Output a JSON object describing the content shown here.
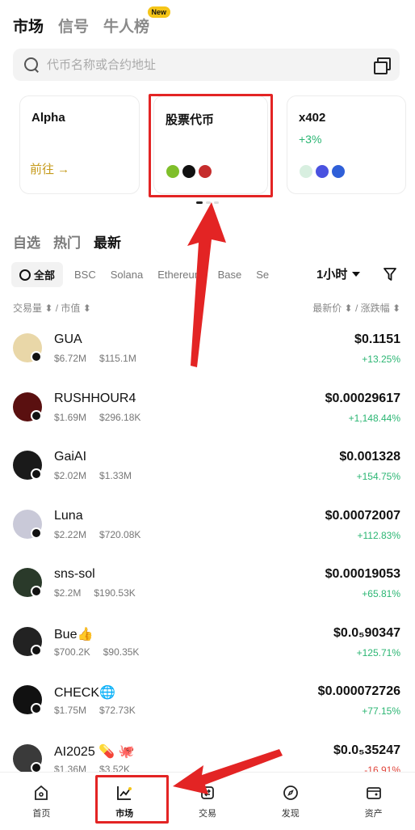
{
  "top_tabs": [
    {
      "label": "市场",
      "active": true
    },
    {
      "label": "信号",
      "active": false
    },
    {
      "label": "牛人榜",
      "active": false,
      "badge": "New"
    }
  ],
  "search": {
    "placeholder": "代币名称或合约地址"
  },
  "cards": [
    {
      "title": "Alpha",
      "action": "前往 →"
    },
    {
      "title": "股票代币"
    },
    {
      "title": "x402",
      "change": "+3%"
    }
  ],
  "sub_tabs": [
    {
      "label": "自选",
      "active": false
    },
    {
      "label": "热门",
      "active": false
    },
    {
      "label": "最新",
      "active": true
    }
  ],
  "chains": [
    {
      "label": "全部",
      "active": true
    },
    {
      "label": "BSC"
    },
    {
      "label": "Solana"
    },
    {
      "label": "Ethereum"
    },
    {
      "label": "Base"
    },
    {
      "label": "Se"
    }
  ],
  "timeframe": "1小时",
  "columns": {
    "left": "交易量 ⬍ / 市值 ⬍",
    "right": "最新价 ⬍ / 涨跌幅 ⬍"
  },
  "tokens": [
    {
      "name": "GUA",
      "volume": "$6.72M",
      "mcap": "$115.1M",
      "price": "$0.1151",
      "change": "+13.25%",
      "dir": "up",
      "color": "#e9d7a8"
    },
    {
      "name": "RUSHHOUR4",
      "volume": "$1.69M",
      "mcap": "$296.18K",
      "price": "$0.00029617",
      "change": "+1,148.44%",
      "dir": "up",
      "color": "#5a1010"
    },
    {
      "name": "GaiAI",
      "volume": "$2.02M",
      "mcap": "$1.33M",
      "price": "$0.001328",
      "change": "+154.75%",
      "dir": "up",
      "color": "#1a1a1a"
    },
    {
      "name": "Luna",
      "volume": "$2.22M",
      "mcap": "$720.08K",
      "price": "$0.00072007",
      "change": "+112.83%",
      "dir": "up",
      "color": "#c9c9d8"
    },
    {
      "name": "sns-sol",
      "volume": "$2.2M",
      "mcap": "$190.53K",
      "price": "$0.00019053",
      "change": "+65.81%",
      "dir": "up",
      "color": "#2a3a2a"
    },
    {
      "name": "Bue👍",
      "volume": "$700.2K",
      "mcap": "$90.35K",
      "price": "$0.0₅90347",
      "change": "+125.71%",
      "dir": "up",
      "color": "#222222"
    },
    {
      "name": "CHECK🌐",
      "volume": "$1.75M",
      "mcap": "$72.73K",
      "price": "$0.000072726",
      "change": "+77.15%",
      "dir": "up",
      "color": "#111111"
    },
    {
      "name": "AI2025 💊 🐙",
      "volume": "$1.36M",
      "mcap": "$3.52K",
      "price": "$0.0₅35247",
      "change": "-16.91%",
      "dir": "down",
      "color": "#3a3a3a"
    }
  ],
  "nav": [
    {
      "label": "首页",
      "icon": "home-icon"
    },
    {
      "label": "市场",
      "icon": "chart-icon"
    },
    {
      "label": "交易",
      "icon": "swap-icon"
    },
    {
      "label": "发现",
      "icon": "compass-icon"
    },
    {
      "label": "资产",
      "icon": "wallet-icon"
    }
  ],
  "colors": {
    "accent_red": "#e32424",
    "up": "#2bb673",
    "down": "#e0463c",
    "gold": "#c59a1a"
  }
}
